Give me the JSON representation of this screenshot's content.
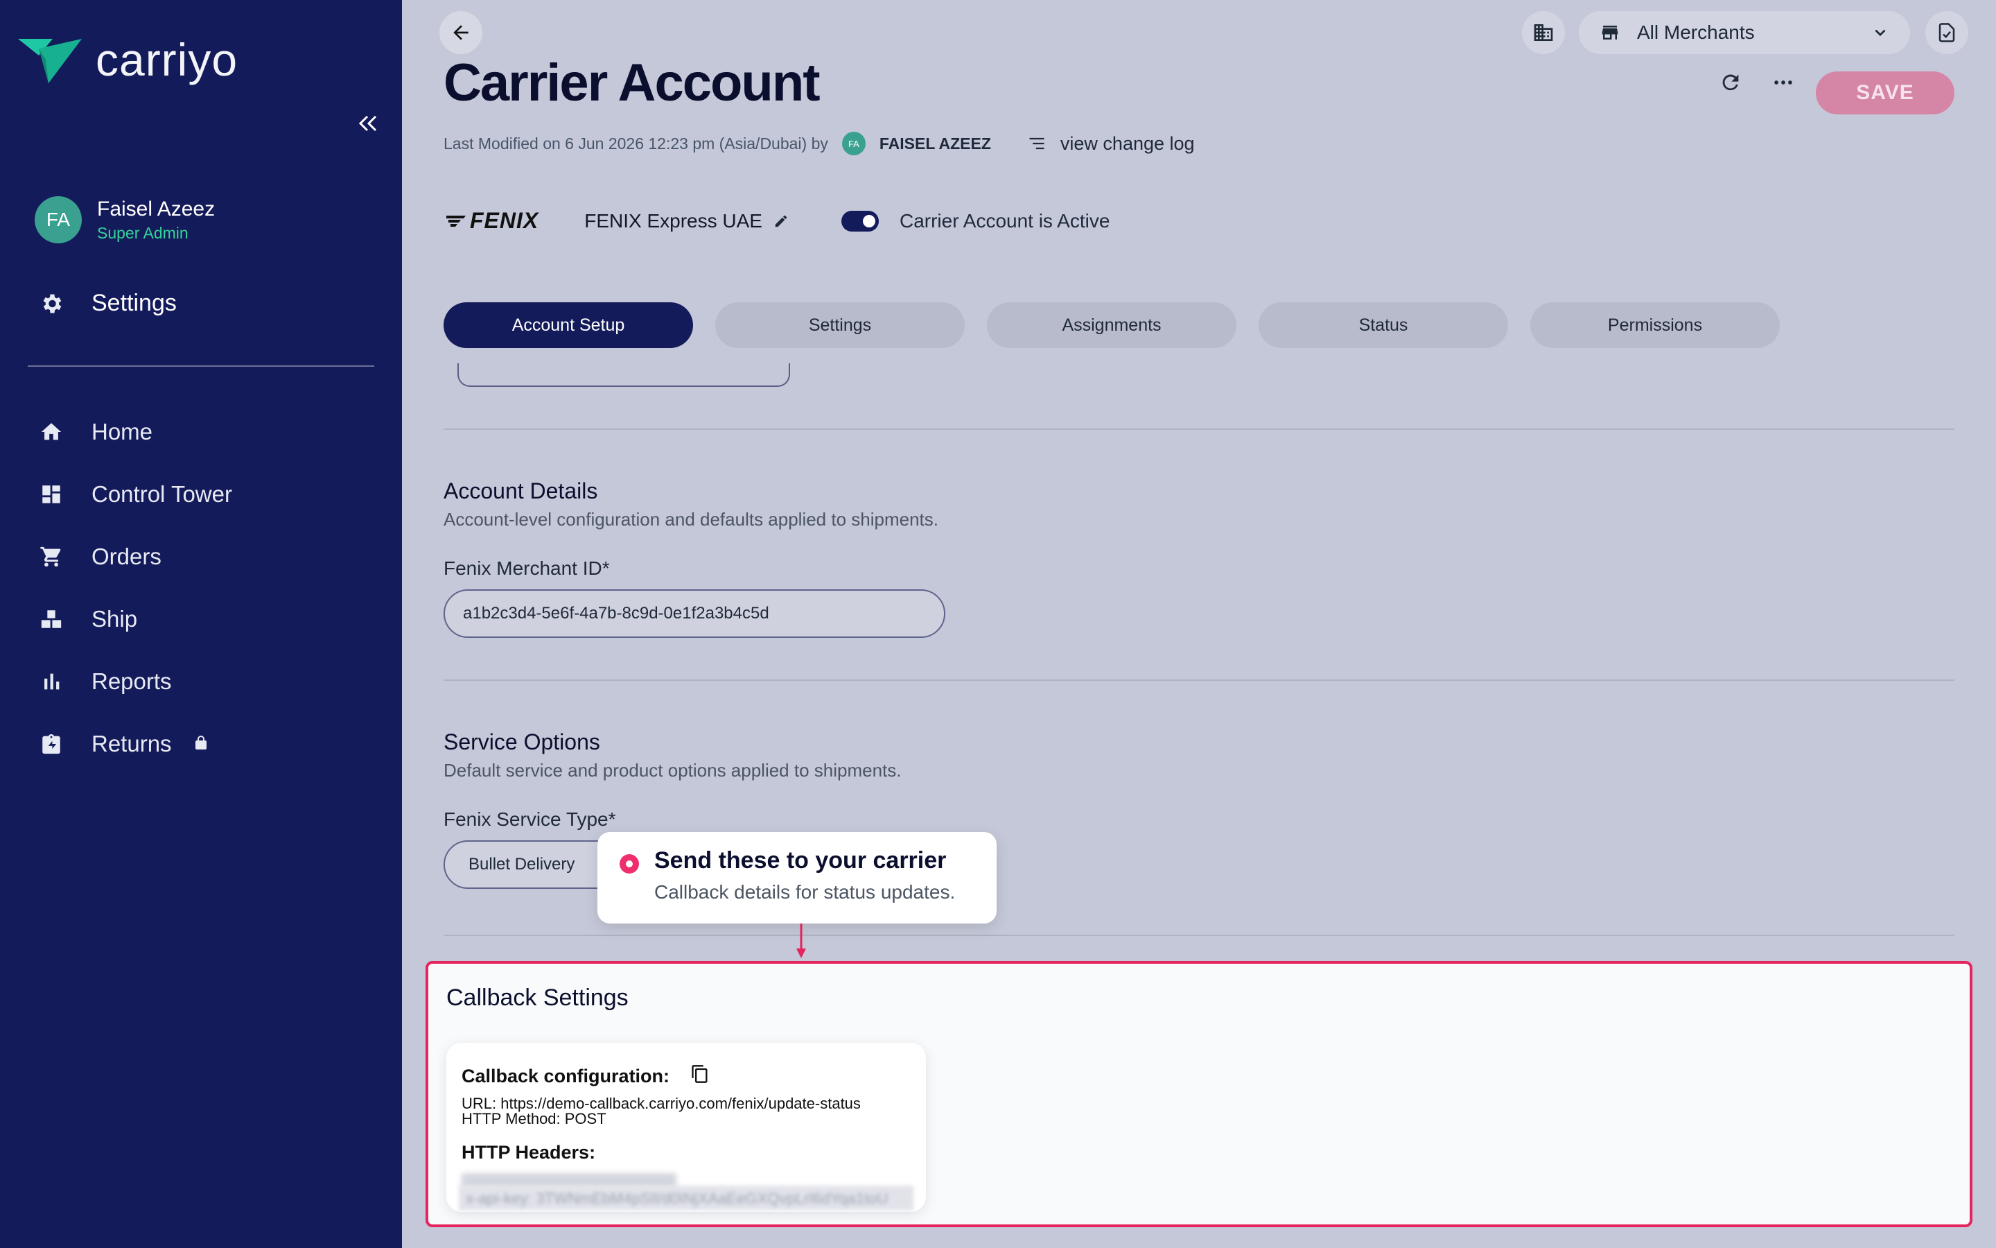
{
  "app": {
    "logo_text": "carriyo",
    "brand_color": "#1fc8a5"
  },
  "user": {
    "initials": "FA",
    "name": "Faisel Azeez",
    "role": "Super Admin"
  },
  "sidebar": {
    "settings_label": "Settings",
    "items": [
      {
        "label": "Home",
        "icon": "home-icon"
      },
      {
        "label": "Control Tower",
        "icon": "dashboard-icon"
      },
      {
        "label": "Orders",
        "icon": "cart-icon"
      },
      {
        "label": "Ship",
        "icon": "boxes-icon"
      },
      {
        "label": "Reports",
        "icon": "bar-chart-icon"
      },
      {
        "label": "Returns",
        "icon": "return-icon",
        "locked": true
      }
    ]
  },
  "topbar": {
    "merchant_select": "All Merchants"
  },
  "page": {
    "title": "Carrier Account",
    "save_label": "SAVE",
    "meta": {
      "last_modified": "Last Modified on 6 Jun 2026 12:23 pm (Asia/Dubai) by",
      "modifier_initials": "FA",
      "modifier_name": "FAISEL AZEEZ",
      "change_log": "view change log"
    },
    "carrier": {
      "logo": "FENIX",
      "account_name": "FENIX Express UAE",
      "active_label": "Carrier Account is Active",
      "active": true
    },
    "tabs": [
      {
        "label": "Account Setup",
        "active": true
      },
      {
        "label": "Settings",
        "active": false
      },
      {
        "label": "Assignments",
        "active": false
      },
      {
        "label": "Status",
        "active": false
      },
      {
        "label": "Permissions",
        "active": false
      }
    ]
  },
  "account_details": {
    "title": "Account Details",
    "subtitle": "Account-level configuration and defaults applied to shipments.",
    "merchant_id_label": "Fenix Merchant ID*",
    "merchant_id_value": "a1b2c3d4-5e6f-4a7b-8c9d-0e1f2a3b4c5d"
  },
  "service_options": {
    "title": "Service Options",
    "subtitle": "Default service and product options applied to shipments.",
    "service_type_label": "Fenix Service Type*",
    "service_type_value": "Bullet Delivery"
  },
  "tooltip": {
    "title": "Send these to your carrier",
    "subtitle": "Callback details for status updates."
  },
  "callback": {
    "title": "Callback Settings",
    "config_label": "Callback configuration:",
    "url_line": "URL: https://demo-callback.carriyo.com/fenix/update-status",
    "method_line": "HTTP Method: POST",
    "headers_label": "HTTP Headers:",
    "headers_value": "x-api-key: 3TWNmEbM4pSIl/d0INjXAaEeGXQvpLrI6dYqa1toU"
  }
}
